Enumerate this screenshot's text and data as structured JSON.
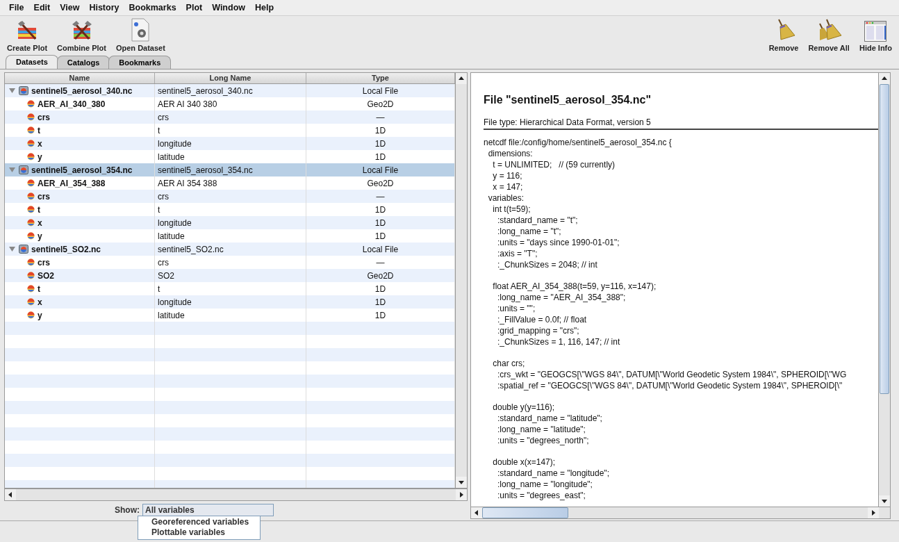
{
  "menu": [
    "File",
    "Edit",
    "View",
    "History",
    "Bookmarks",
    "Plot",
    "Window",
    "Help"
  ],
  "toolbar_left": [
    {
      "label": "Create Plot",
      "kind": "create"
    },
    {
      "label": "Combine Plot",
      "kind": "combine"
    },
    {
      "label": "Open Dataset",
      "kind": "open"
    }
  ],
  "toolbar_right": [
    {
      "label": "Remove",
      "kind": "remove"
    },
    {
      "label": "Remove All",
      "kind": "remove_all"
    },
    {
      "label": "Hide Info",
      "kind": "info"
    }
  ],
  "tabs": [
    {
      "label": "Datasets",
      "selected": true
    },
    {
      "label": "Catalogs",
      "selected": false
    },
    {
      "label": "Bookmarks",
      "selected": false
    }
  ],
  "table": {
    "columns": [
      "Name",
      "Long Name",
      "Type"
    ],
    "rows": [
      {
        "name": "sentinel5_aerosol_340.nc",
        "long_name": "sentinel5_aerosol_340.nc",
        "type": "Local File",
        "expanded": true,
        "selected": false,
        "children": [
          {
            "name": "AER_AI_340_380",
            "long_name": "AER AI 340 380",
            "type": "Geo2D",
            "selected": false
          },
          {
            "name": "crs",
            "long_name": "crs",
            "type": "—",
            "selected": false
          },
          {
            "name": "t",
            "long_name": "t",
            "type": "1D",
            "selected": false
          },
          {
            "name": "x",
            "long_name": "longitude",
            "type": "1D",
            "selected": false
          },
          {
            "name": "y",
            "long_name": "latitude",
            "type": "1D",
            "selected": false
          }
        ]
      },
      {
        "name": "sentinel5_aerosol_354.nc",
        "long_name": "sentinel5_aerosol_354.nc",
        "type": "Local File",
        "expanded": true,
        "selected": true,
        "children": [
          {
            "name": "AER_AI_354_388",
            "long_name": "AER AI 354 388",
            "type": "Geo2D",
            "selected": false
          },
          {
            "name": "crs",
            "long_name": "crs",
            "type": "—",
            "selected": false
          },
          {
            "name": "t",
            "long_name": "t",
            "type": "1D",
            "selected": false
          },
          {
            "name": "x",
            "long_name": "longitude",
            "type": "1D",
            "selected": false
          },
          {
            "name": "y",
            "long_name": "latitude",
            "type": "1D",
            "selected": false
          }
        ]
      },
      {
        "name": "sentinel5_SO2.nc",
        "long_name": "sentinel5_SO2.nc",
        "type": "Local File",
        "expanded": true,
        "selected": false,
        "children": [
          {
            "name": "crs",
            "long_name": "crs",
            "type": "—",
            "selected": false
          },
          {
            "name": "SO2",
            "long_name": "SO2",
            "type": "Geo2D",
            "selected": false
          },
          {
            "name": "t",
            "long_name": "t",
            "type": "1D",
            "selected": false
          },
          {
            "name": "x",
            "long_name": "longitude",
            "type": "1D",
            "selected": false
          },
          {
            "name": "y",
            "long_name": "latitude",
            "type": "1D",
            "selected": false
          }
        ]
      }
    ]
  },
  "show": {
    "label": "Show:",
    "value": "All variables",
    "options": [
      "Georeferenced variables",
      "Plottable variables"
    ]
  },
  "info": {
    "title": "File \"sentinel5_aerosol_354.nc\"",
    "file_type": "File type: Hierarchical Data Format, version 5",
    "code_blocks": [
      [
        "netcdf file:/config/home/sentinel5_aerosol_354.nc {",
        "  dimensions:",
        "    t = UNLIMITED;   // (59 currently)",
        "    y = 116;",
        "    x = 147;",
        "  variables:",
        "    int t(t=59);",
        "      :standard_name = \"t\";",
        "      :long_name = \"t\";",
        "      :units = \"days since 1990-01-01\";",
        "      :axis = \"T\";",
        "      :_ChunkSizes = 2048; // int"
      ],
      [
        "    float AER_AI_354_388(t=59, y=116, x=147);",
        "      :long_name = \"AER_AI_354_388\";",
        "      :units = \"\";",
        "      :_FillValue = 0.0f; // float",
        "      :grid_mapping = \"crs\";",
        "      :_ChunkSizes = 1, 116, 147; // int"
      ],
      [
        "    char crs;",
        "      :crs_wkt = \"GEOGCS[\\\"WGS 84\\\", DATUM[\\\"World Geodetic System 1984\\\", SPHEROID[\\\"WG",
        "      :spatial_ref = \"GEOGCS[\\\"WGS 84\\\", DATUM[\\\"World Geodetic System 1984\\\", SPHEROID[\\\""
      ],
      [
        "    double y(y=116);",
        "      :standard_name = \"latitude\";",
        "      :long_name = \"latitude\";",
        "      :units = \"degrees_north\";"
      ],
      [
        "    double x(x=147);",
        "      :standard_name = \"longitude\";",
        "      :long_name = \"longitude\";",
        "      :units = \"degrees_east\";"
      ]
    ]
  }
}
